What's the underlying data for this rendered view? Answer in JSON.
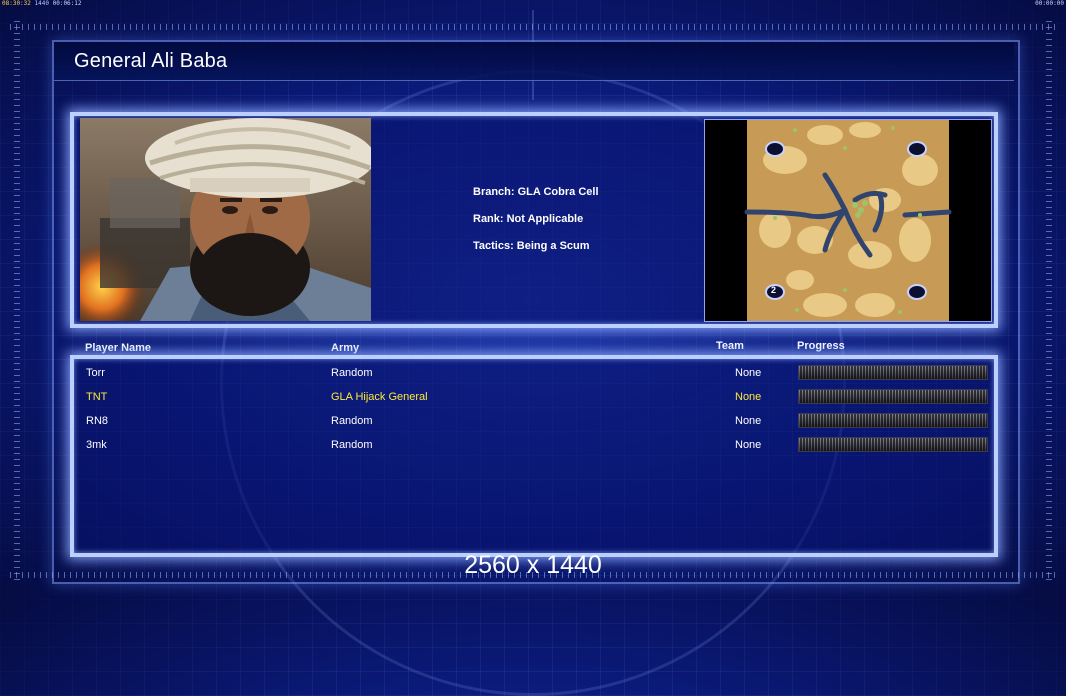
{
  "topbar": {
    "left_a": "08:30:32",
    "left_b": "1440",
    "left_c": "00:06:12",
    "right": "00:00:00"
  },
  "title": "General Ali Baba",
  "general": {
    "branch": "Branch: GLA Cobra Cell",
    "rank": "Rank: Not Applicable",
    "tactics": "Tactics: Being a Scum"
  },
  "minimap": {
    "start_label": "2"
  },
  "table": {
    "headers": {
      "player": "Player Name",
      "army": "Army",
      "team": "Team",
      "progress": "Progress"
    },
    "rows": [
      {
        "name": "Torr",
        "army": "Random",
        "team": "None",
        "progress": 1.0,
        "highlight": false
      },
      {
        "name": "TNT",
        "army": "GLA Hijack General",
        "team": "None",
        "progress": 1.0,
        "highlight": true
      },
      {
        "name": "RN8",
        "army": "Random",
        "team": "None",
        "progress": 1.0,
        "highlight": false
      },
      {
        "name": "3mk",
        "army": "Random",
        "team": "None",
        "progress": 1.0,
        "highlight": false
      }
    ]
  },
  "resolution": "2560 x 1440",
  "colors": {
    "highlight": "#ffe93a",
    "panel_glow": "#bcd0ff",
    "background": "#0a1a78"
  }
}
